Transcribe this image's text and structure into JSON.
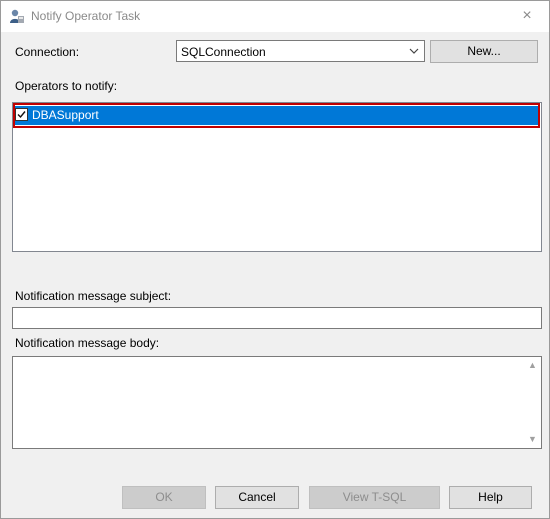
{
  "window": {
    "title": "Notify Operator Task",
    "close_icon": "×"
  },
  "connection": {
    "label": "Connection:",
    "value": "SQLConnection",
    "new_button": "New..."
  },
  "operators": {
    "label": "Operators to notify:",
    "items": [
      {
        "name": "DBASupport",
        "checked": true
      }
    ]
  },
  "subject": {
    "label": "Notification message subject:",
    "value": ""
  },
  "body": {
    "label": "Notification message body:",
    "value": ""
  },
  "buttons": {
    "ok": "OK",
    "cancel": "Cancel",
    "view_tsql": "View T-SQL",
    "help": "Help"
  },
  "colors": {
    "selection": "#0078d7",
    "highlight_border": "#c00000"
  }
}
